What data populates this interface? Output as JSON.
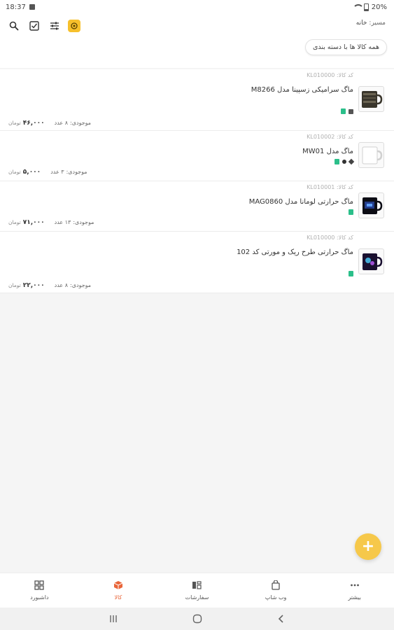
{
  "status_bar": {
    "time": "18:37",
    "battery": "20%"
  },
  "header": {
    "breadcrumb_label": "مسیر:",
    "breadcrumb_value": "خانه",
    "filter_chip": "همه کالا ها با دسته بندی"
  },
  "products": [
    {
      "code": "کد کالا: KL010000",
      "title": "ماگ سرامیکی زسپینا مدل M8266",
      "stock_label": "موجودی:",
      "stock_value": "۸ عدد",
      "price": "۴۶,۰۰۰",
      "currency": "تومان"
    },
    {
      "code": "کد کالا: KL010002",
      "title": "ماگ مدل MW01",
      "stock_label": "موجودی:",
      "stock_value": "۳ عدد",
      "price": "۵,۰۰۰",
      "currency": "تومان"
    },
    {
      "code": "کد کالا: KL010001",
      "title": "ماگ حرارتی لومانا مدل MAG0860",
      "stock_label": "موجودی:",
      "stock_value": "۱۳ عدد",
      "price": "۷۱,۰۰۰",
      "currency": "تومان"
    },
    {
      "code": "کد کالا: KL010000",
      "title": "ماگ حرارتی طرح ریک و مورتی کد 102",
      "stock_label": "موجودی:",
      "stock_value": "۸ عدد",
      "price": "۲۲,۰۰۰",
      "currency": "تومان"
    }
  ],
  "bottom_nav": [
    {
      "label": "داشبورد",
      "icon": "dashboard-icon"
    },
    {
      "label": "کالا",
      "icon": "box-icon",
      "active": true
    },
    {
      "label": "سفارشات",
      "icon": "orders-icon"
    },
    {
      "label": "وب شاپ",
      "icon": "webshop-icon"
    },
    {
      "label": "بیشتر",
      "icon": "more-icon"
    }
  ],
  "colors": {
    "accent": "#f6c02c",
    "active_nav": "#e9663a",
    "shop_badge": "#2bbf8a"
  }
}
